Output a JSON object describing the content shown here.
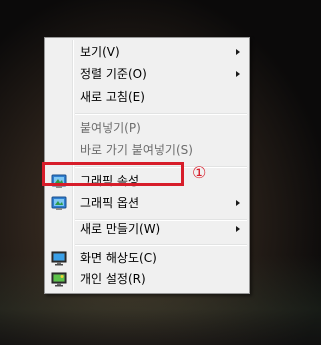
{
  "context_menu": {
    "items": [
      {
        "label": "보기(V)",
        "submenu": true,
        "disabled": false
      },
      {
        "label": "정렬 기준(O)",
        "submenu": true,
        "disabled": false
      },
      {
        "label": "새로 고침(E)",
        "submenu": false,
        "disabled": false
      },
      {
        "label": "붙여넣기(P)",
        "submenu": false,
        "disabled": true
      },
      {
        "label": "바로 가기 붙여넣기(S)",
        "submenu": false,
        "disabled": true
      },
      {
        "label": "그래픽 속성...",
        "submenu": false,
        "disabled": false,
        "icon": "intel-graphics-icon"
      },
      {
        "label": "그래픽 옵션",
        "submenu": true,
        "disabled": false,
        "icon": "intel-graphics-icon"
      },
      {
        "label": "새로 만들기(W)",
        "submenu": true,
        "disabled": false
      },
      {
        "label": "화면 해상도(C)",
        "submenu": false,
        "disabled": false,
        "icon": "monitor-resolution-icon"
      },
      {
        "label": "개인 설정(R)",
        "submenu": false,
        "disabled": false,
        "icon": "personalize-icon"
      }
    ]
  },
  "annotation": {
    "marker": "①",
    "color": "#d71d2a"
  }
}
